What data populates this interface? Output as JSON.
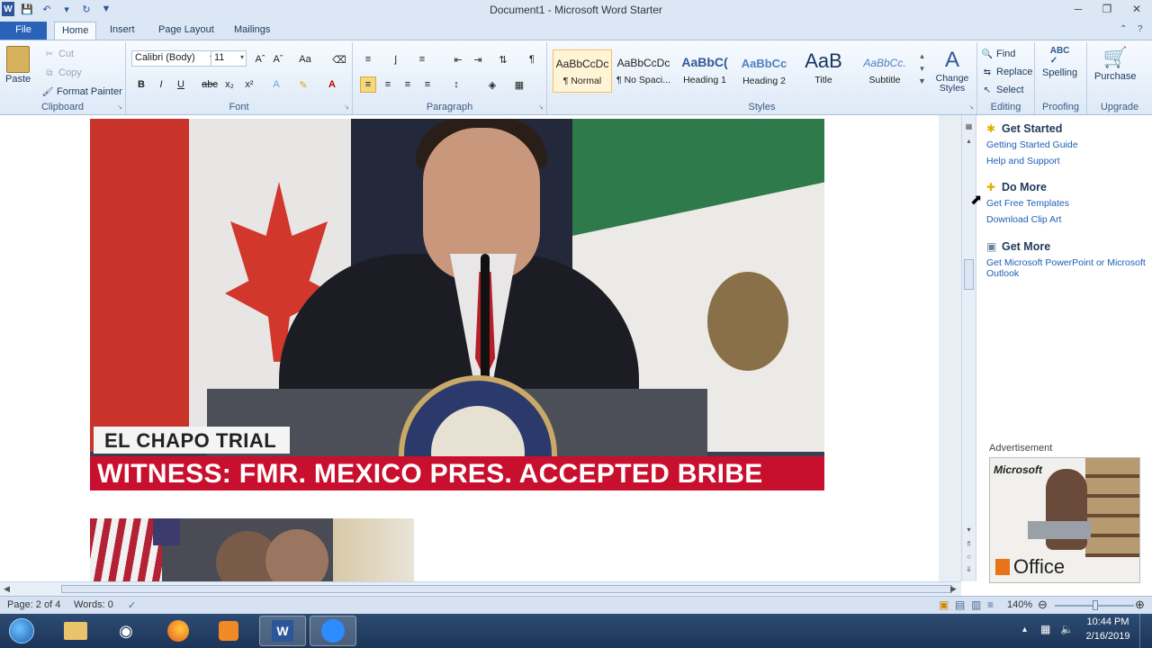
{
  "window": {
    "title": "Document1  -  Microsoft Word Starter"
  },
  "tabs": [
    "File",
    "Home",
    "Insert",
    "Page Layout",
    "Mailings"
  ],
  "clipboard": {
    "paste": "Paste",
    "cut": "Cut",
    "copy": "Copy",
    "format_painter": "Format Painter",
    "label": "Clipboard"
  },
  "font": {
    "name": "Calibri (Body)",
    "size": "11",
    "label": "Font"
  },
  "paragraph": {
    "label": "Paragraph"
  },
  "styles": {
    "items": [
      {
        "sample": "AaBbCcDc",
        "name": "¶ Normal"
      },
      {
        "sample": "AaBbCcDc",
        "name": "¶ No Spaci..."
      },
      {
        "sample": "AaBbC(",
        "name": "Heading 1"
      },
      {
        "sample": "AaBbCc",
        "name": "Heading 2"
      },
      {
        "sample": "AaB",
        "name": "Title"
      },
      {
        "sample": "AaBbCc.",
        "name": "Subtitle"
      }
    ],
    "change_styles": "Change Styles",
    "label": "Styles"
  },
  "editing": {
    "find": "Find",
    "replace": "Replace",
    "select": "Select",
    "label": "Editing"
  },
  "proofing": {
    "spelling": "Spelling",
    "label": "Proofing"
  },
  "upgrade": {
    "purchase": "Purchase",
    "label": "Upgrade"
  },
  "document": {
    "lower_third_tag": "EL CHAPO TRIAL",
    "headline": "WITNESS: FMR. MEXICO PRES. ACCEPTED BRIBE"
  },
  "side_pane": {
    "get_started": {
      "heading": "Get Started",
      "links": [
        "Getting Started Guide",
        "Help and Support"
      ]
    },
    "do_more": {
      "heading": "Do More",
      "links": [
        "Get Free Templates",
        "Download Clip Art"
      ]
    },
    "get_more": {
      "heading": "Get More",
      "links": [
        "Get Microsoft PowerPoint or Microsoft Outlook"
      ]
    },
    "ad_label": "Advertisement",
    "ad_brand": "Microsoft",
    "ad_product": "Office"
  },
  "status": {
    "page": "Page: 2 of 4",
    "words": "Words: 0",
    "zoom": "140%"
  },
  "taskbar": {
    "time": "10:44 PM",
    "date": "2/16/2019"
  },
  "colors": {
    "file_tab": "#2a62b8",
    "headline_bar": "#c8102e",
    "link": "#1d5fb5"
  }
}
